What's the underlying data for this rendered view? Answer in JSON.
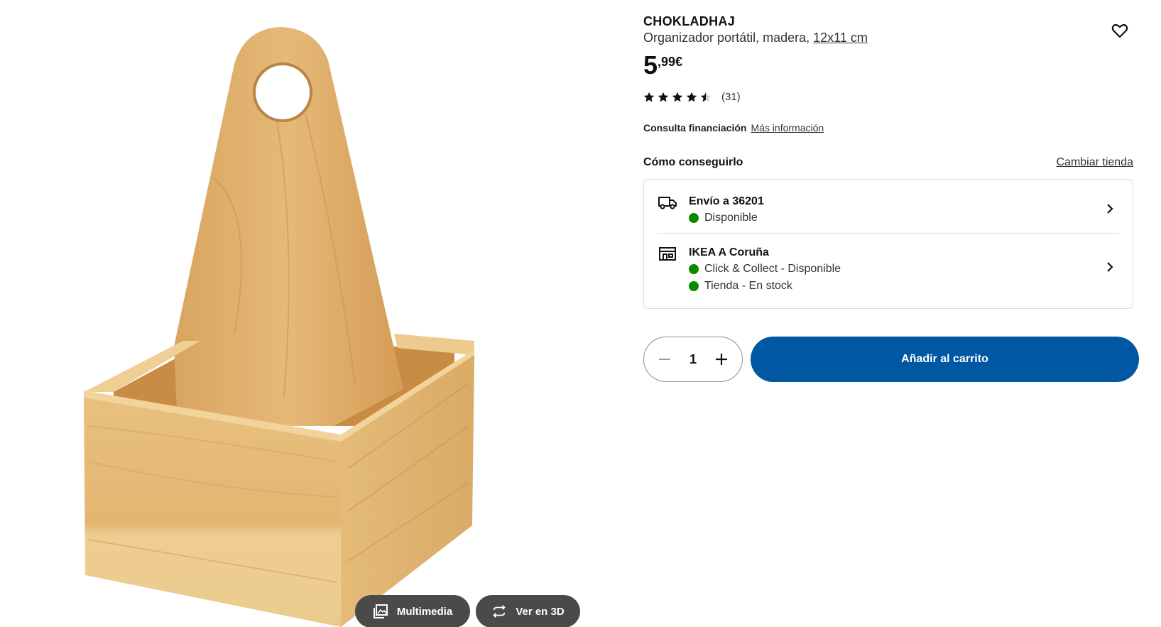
{
  "product": {
    "name": "CHOKLADHAJ",
    "description": "Organizador portátil, madera, ",
    "size": "12x11 cm",
    "price_int": "5",
    "price_dec": ",99",
    "price_currency": "€",
    "rating_value": 4.5,
    "rating_max": 5,
    "rating_count": "(31)"
  },
  "media": {
    "multimedia_label": "Multimedia",
    "view3d_label": "Ver en 3D"
  },
  "finance": {
    "label": "Consulta financiación",
    "link": "Más información"
  },
  "availability": {
    "heading": "Cómo conseguirlo",
    "change_store": "Cambiar tienda",
    "delivery": {
      "title": "Envío a 36201",
      "status": "Disponible"
    },
    "store": {
      "title": "IKEA A Coruña",
      "status_collect": "Click & Collect - Disponible",
      "status_stock": "Tienda - En stock"
    }
  },
  "cart": {
    "quantity": "1",
    "add_label": "Añadir al carrito"
  },
  "colors": {
    "primary_blue": "#0058a3",
    "available_green": "#0a8a00",
    "media_button": "#4a4a4a"
  },
  "icons": {
    "favorite": "heart-icon",
    "delivery": "truck-icon",
    "store": "store-icon",
    "chevron": "chevron-right-icon",
    "minus": "minus-icon",
    "plus": "plus-icon",
    "multimedia": "gallery-icon",
    "view3d": "rotate-3d-icon"
  }
}
